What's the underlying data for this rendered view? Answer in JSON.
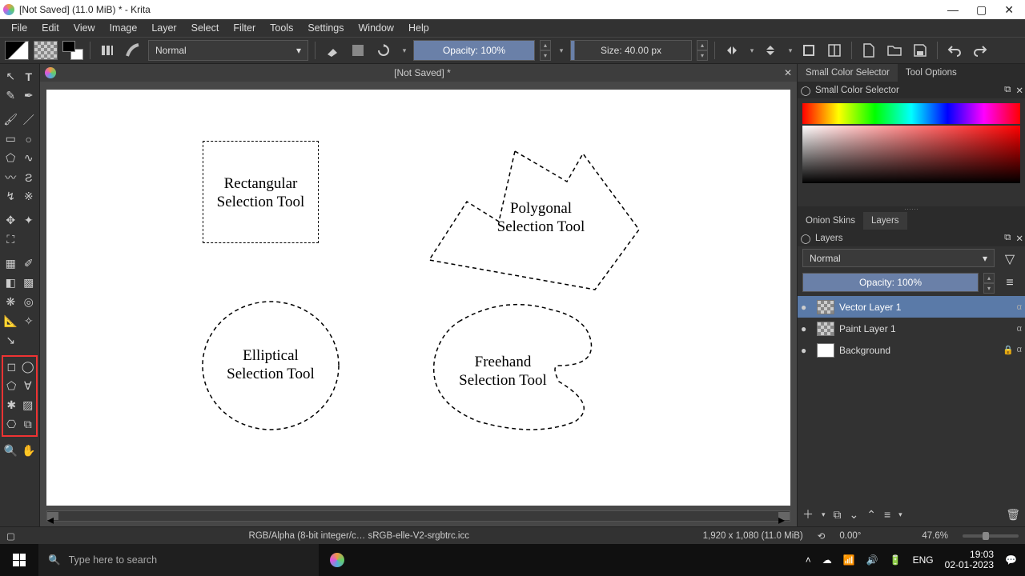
{
  "title": "[Not Saved]  (11.0 MiB)  * - Krita",
  "menu": [
    "File",
    "Edit",
    "View",
    "Image",
    "Layer",
    "Select",
    "Filter",
    "Tools",
    "Settings",
    "Window",
    "Help"
  ],
  "toolbar": {
    "blend_mode": "Normal",
    "opacity": "Opacity: 100%",
    "size": "Size: 40.00 px"
  },
  "document": {
    "tab": "[Not Saved]  *"
  },
  "canvas": {
    "rect_label": "Rectangular\nSelection Tool",
    "poly_label": "Polygonal\nSelection Tool",
    "ellipse_label": "Elliptical\nSelection Tool",
    "freehand_label": "Freehand\nSelection Tool"
  },
  "panels": {
    "tabs_top": {
      "scs": "Small Color Selector",
      "opts": "Tool Options"
    },
    "scs_header": "Small Color Selector",
    "tabs_mid": {
      "onion": "Onion Skins",
      "layers": "Layers"
    },
    "layers_header": "Layers",
    "layer_blend": "Normal",
    "layer_opacity": "Opacity:  100%",
    "layer_items": [
      {
        "name": "Vector Layer 1",
        "locked": false,
        "selected": true,
        "transparent": true
      },
      {
        "name": "Paint Layer 1",
        "locked": false,
        "selected": false,
        "transparent": true
      },
      {
        "name": "Background",
        "locked": true,
        "selected": false,
        "transparent": false
      }
    ]
  },
  "status": {
    "colorspace": "RGB/Alpha (8-bit integer/c…   sRGB-elle-V2-srgbtrc.icc",
    "dims": "1,920 x 1,080 (11.0 MiB)",
    "angle": "0.00°",
    "zoom": "47.6%"
  },
  "taskbar": {
    "search_placeholder": "Type here to search",
    "lang": "ENG",
    "time": "19:03",
    "date": "02-01-2023"
  }
}
